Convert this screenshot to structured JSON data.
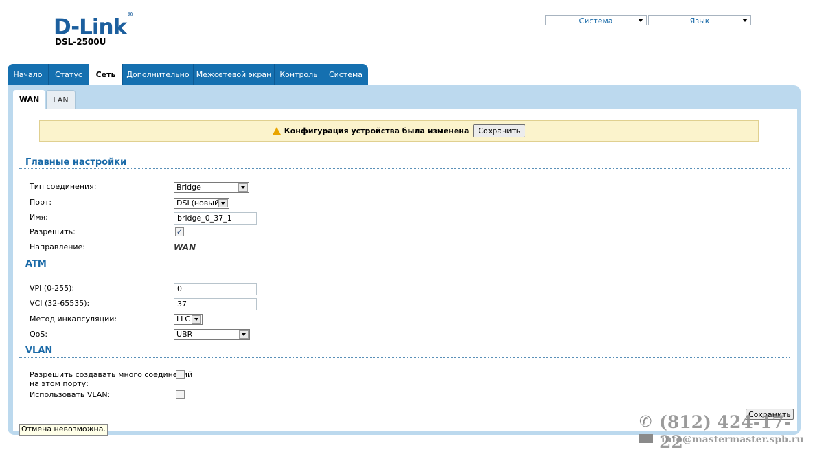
{
  "brand": {
    "logo": "D-Link",
    "reg": "®",
    "model": "DSL-2500U"
  },
  "top_menus": {
    "system": "Система",
    "language": "Язык"
  },
  "tabs": [
    "Начало",
    "Статус",
    "Сеть",
    "Дополнительно",
    "Межсетевой экран",
    "Контроль",
    "Система"
  ],
  "active_tab": "Сеть",
  "subtabs": {
    "wan": "WAN",
    "lan": "LAN"
  },
  "notice": {
    "text": "Конфигурация устройства была изменена",
    "save_label": "Сохранить"
  },
  "main": {
    "title": "Главные настройки",
    "connection_type_label": "Тип соединения:",
    "connection_type_value": "Bridge",
    "port_label": "Порт:",
    "port_value": "DSL(новый)",
    "name_label": "Имя:",
    "name_value": "bridge_0_37_1",
    "enable_label": "Разрешить:",
    "enable_checked": true,
    "direction_label": "Направление:",
    "direction_value": "WAN"
  },
  "atm": {
    "title": "ATM",
    "vpi_label": "VPI (0-255):",
    "vpi_value": "0",
    "vci_label": "VCI (32-65535):",
    "vci_value": "37",
    "encap_label": "Метод инкапсуляции:",
    "encap_value": "LLC",
    "qos_label": "QoS:",
    "qos_value": "UBR"
  },
  "vlan": {
    "title": "VLAN",
    "multi_label_1": "Разрешить создавать много соединений",
    "multi_label_2": "на этом порту:",
    "multi_checked": false,
    "use_vlan_label": "Использовать VLAN:",
    "use_vlan_checked": false
  },
  "footer": {
    "status_text": "Отмена невозможна.",
    "save_label": "Сохранить"
  },
  "watermark": {
    "phone": "(812) 424-17-22",
    "email": "info@mastermaster.spb.ru"
  }
}
